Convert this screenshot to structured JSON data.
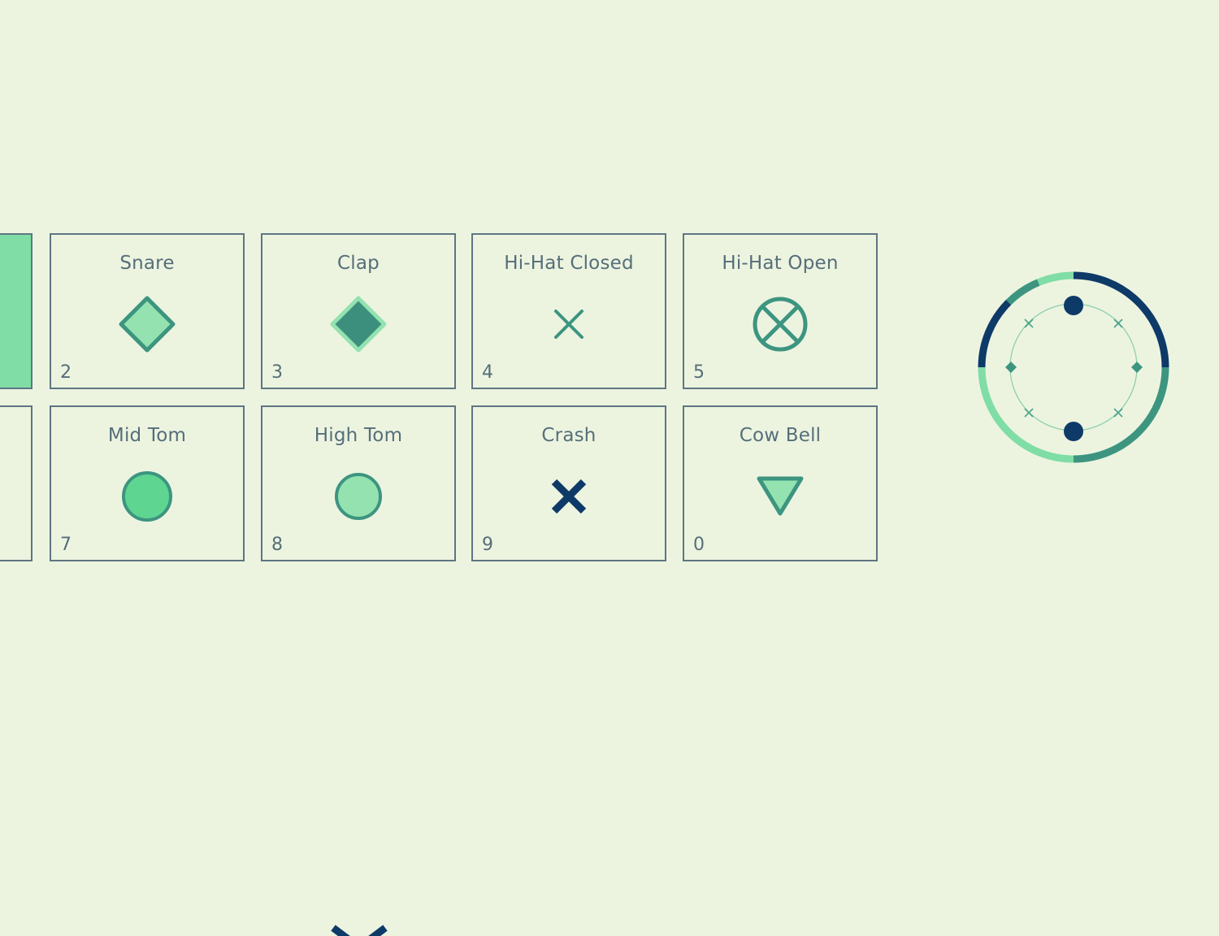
{
  "pads": [
    {
      "id": "kick",
      "key": "",
      "label": "",
      "icon": "active-pad",
      "active": true
    },
    {
      "id": "snare",
      "key": "2",
      "label": "Snare",
      "icon": "diamond-outline-icon",
      "active": false
    },
    {
      "id": "clap",
      "key": "3",
      "label": "Clap",
      "icon": "diamond-filled-icon",
      "active": false
    },
    {
      "id": "hihat-closed",
      "key": "4",
      "label": "Hi-Hat Closed",
      "icon": "x-thin-icon",
      "active": false
    },
    {
      "id": "hihat-open",
      "key": "5",
      "label": "Hi-Hat Open",
      "icon": "circle-x-icon",
      "active": false
    },
    {
      "id": "low-tom",
      "key": "",
      "label": "",
      "icon": "",
      "active": false
    },
    {
      "id": "mid-tom",
      "key": "7",
      "label": "Mid Tom",
      "icon": "circle-filled-icon",
      "active": false
    },
    {
      "id": "high-tom",
      "key": "8",
      "label": "High Tom",
      "icon": "circle-light-icon",
      "active": false
    },
    {
      "id": "crash",
      "key": "9",
      "label": "Crash",
      "icon": "x-bold-icon",
      "active": false
    },
    {
      "id": "cow-bell",
      "key": "0",
      "label": "Cow Bell",
      "icon": "triangle-down-icon",
      "active": false
    }
  ],
  "tempo_ring": {
    "icon": "beat-ring-icon",
    "steps": 8
  },
  "colors": {
    "background": "#ecf4e0",
    "border": "#5f7583",
    "text": "#566e79",
    "mint": "#7fdda5",
    "mint_light": "#94e2b0",
    "teal": "#3d9580",
    "teal_dark": "#3d8f7d",
    "navy": "#0e3a68"
  }
}
